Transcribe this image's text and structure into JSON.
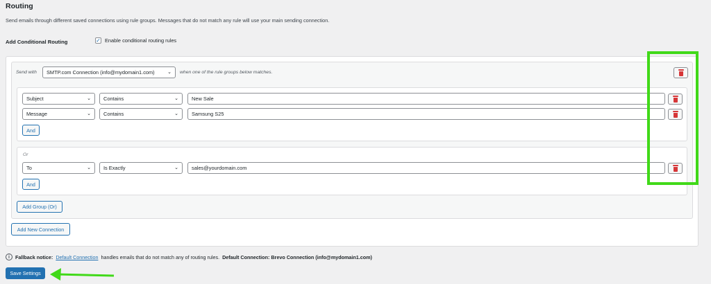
{
  "page": {
    "title": "Routing",
    "description": "Send emails through different saved connections using rule groups. Messages that do not match any rule will use your main sending connection."
  },
  "conditional": {
    "label": "Add Conditional Routing",
    "checkbox_label": "Enable conditional routing rules",
    "checked": true
  },
  "connection": {
    "send_with_label": "Send with",
    "selected_connection": "SMTP.com Connection (info@mydomain1.com)",
    "when_text": "when one of the rule groups below matches."
  },
  "groups": [
    {
      "rules": [
        {
          "field": "Subject",
          "operator": "Contains",
          "value": "New Sale"
        },
        {
          "field": "Message",
          "operator": "Contains",
          "value": "Samsung S25"
        }
      ],
      "and_label": "And"
    },
    {
      "or_label": "Or",
      "rules": [
        {
          "field": "To",
          "operator": "Is Exactly",
          "value": "sales@yourdomain.com"
        }
      ],
      "and_label": "And"
    }
  ],
  "buttons": {
    "add_group": "Add Group (Or)",
    "add_connection": "Add New Connection",
    "save": "Save Settings"
  },
  "fallback": {
    "label": "Fallback notice:",
    "link": "Default Connection",
    "text": "handles emails that do not match any of routing rules.",
    "default_label": "Default Connection: Brevo Connection (info@mydomain1.com)"
  },
  "icons": {
    "delete": "trash-icon",
    "chevron": "chevron-down-icon",
    "info": "info-icon",
    "checkmark": "checkmark-icon"
  },
  "colors": {
    "accent": "#2271b1",
    "danger": "#d63638",
    "highlight": "#41d919"
  }
}
